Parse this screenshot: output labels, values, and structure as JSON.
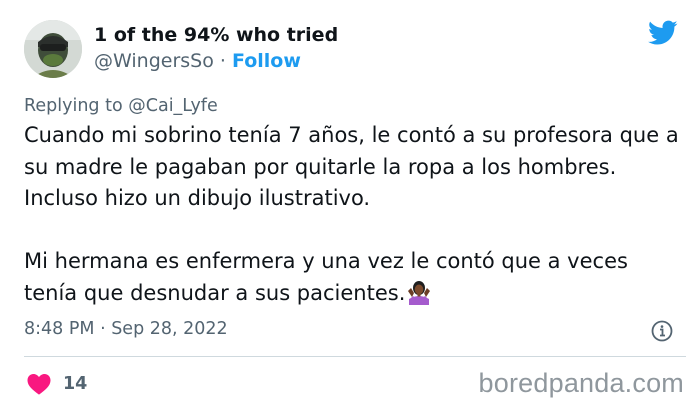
{
  "author": {
    "display_name": "1 of the 94% who tried",
    "handle": "@WingersSo",
    "separator": "·",
    "follow_label": "Follow",
    "avatar_icon": "avatar-photo"
  },
  "platform": {
    "logo_icon": "twitter-bird-icon",
    "accent_color": "#1d9bf0"
  },
  "reply_context": {
    "prefix": "Replying to",
    "mention": "@Cai_Lyfe"
  },
  "tweet": {
    "paragraph_1": "Cuando mi sobrino tenía 7 años, le contó a su profesora que a su madre le pagaban por quitarle la ropa a los hombres. Incluso hizo un dibujo ilustrativo.",
    "paragraph_2": "Mi hermana es enfermera y una vez le contó que a veces tenía que desnudar a sus pacientes.",
    "emoji": "person-shrugging-emoji"
  },
  "meta": {
    "timestamp": "8:48 PM · Sep 28, 2022",
    "info_icon": "info-icon"
  },
  "engagement": {
    "like_icon": "heart-icon",
    "like_color": "#f91880",
    "likes": "14"
  },
  "watermark": "boredpanda.com"
}
